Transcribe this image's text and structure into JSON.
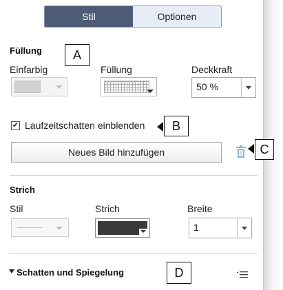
{
  "tabs": [
    {
      "label": "Stil",
      "active": true
    },
    {
      "label": "Optionen",
      "active": false
    }
  ],
  "fill_section": {
    "title": "Füllung",
    "type_label": "Einfarbig",
    "fill_label": "Füllung",
    "opacity_label": "Deckkraft",
    "opacity_value": "50 %"
  },
  "shadow_checkbox": {
    "label": "Laufzeitschatten einblenden",
    "checked": true
  },
  "add_image_button": "Neues Bild hinzufügen",
  "stroke_section": {
    "title": "Strich",
    "style_label": "Stil",
    "stroke_label": "Strich",
    "width_label": "Breite",
    "width_value": "1"
  },
  "shadow_section": {
    "title": "Schatten und Spiegelung"
  },
  "callouts": [
    "A",
    "B",
    "C",
    "D"
  ],
  "colors": {
    "tab_active_bg": "#4e5c77",
    "tab_inactive_bg": "#e7edf6",
    "trash_icon": "#8fb3d9",
    "stroke_color": "#3a3a3a"
  },
  "icons": [
    "trash-icon",
    "list-menu-icon",
    "triangle-down-icon",
    "checkmark-icon"
  ]
}
